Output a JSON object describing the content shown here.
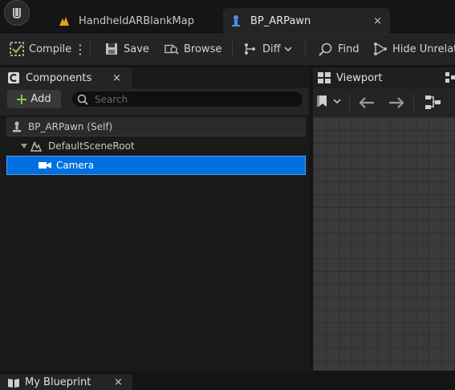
{
  "window": {
    "tabs": [
      {
        "label": "HandheldARBlankMap",
        "icon": "level-map-icon"
      },
      {
        "label": "BP_ARPawn",
        "icon": "pawn-blueprint-icon",
        "close": "×"
      }
    ]
  },
  "toolbar": {
    "compile_label": "Compile",
    "save_label": "Save",
    "browse_label": "Browse",
    "diff_label": "Diff",
    "find_label": "Find",
    "hide_unrelated_label": "Hide Unrelate"
  },
  "components_panel": {
    "title": "Components",
    "close": "×",
    "add_label": "Add",
    "search_placeholder": "Search",
    "tree": [
      {
        "label": "BP_ARPawn (Self)",
        "icon": "pawn-icon"
      },
      {
        "label": "DefaultSceneRoot",
        "icon": "scene-root-icon"
      },
      {
        "label": "Camera",
        "icon": "camera-icon",
        "selected": true
      }
    ]
  },
  "viewport_panel": {
    "title": "Viewport"
  },
  "my_blueprint_panel": {
    "title": "My Blueprint",
    "close": "×"
  },
  "colors": {
    "selection": "#0070e0",
    "add_plus": "#7ec850",
    "map_icon": "#e8a020",
    "pawn_icon": "#4a8ef0"
  }
}
